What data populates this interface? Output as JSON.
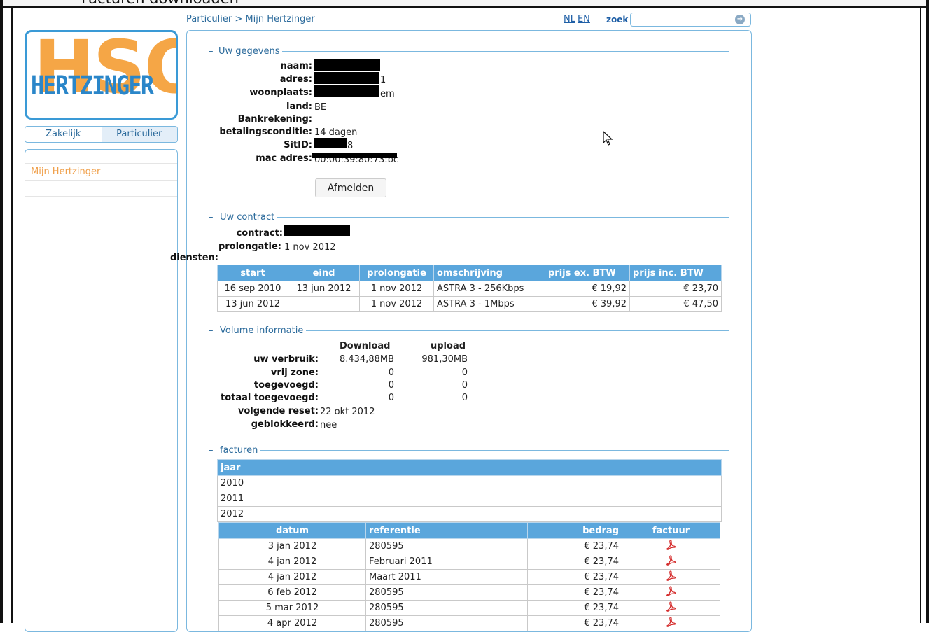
{
  "window": {
    "title": "Facturen downloaden"
  },
  "header": {
    "breadcrumb": "Particulier > Mijn Hertzinger",
    "lang_nl": "NL",
    "lang_en": "EN",
    "search_label": "zoek",
    "search_value": ""
  },
  "sidebar": {
    "logo_letters": "HSO",
    "logo_name": "HERTZINGER",
    "tab_zakelijk": "Zakelijk",
    "tab_particulier": "Particulier",
    "menu_item": "Mijn Hertzinger"
  },
  "gegevens": {
    "legend": "Uw gegevens",
    "naam_label": "naam:",
    "adres_label": "adres:",
    "adres_tail": "1",
    "woonplaats_label": "woonplaats:",
    "woonplaats_tail": "em",
    "land_label": "land:",
    "land_value": "BE",
    "bank_label": "Bankrekening:",
    "betaling_label": "betalingsconditie:",
    "betaling_value": "14 dagen",
    "sitid_label": "SitID:",
    "sitid_tail": "8",
    "mac_label": "mac adres:",
    "mac_value": "00:00:39:80:73:bc",
    "logout": "Afmelden"
  },
  "contract": {
    "legend": "Uw contract",
    "contract_label": "contract:",
    "prolongatie_label": "prolongatie:",
    "prolongatie_value": "1 nov 2012",
    "diensten_label": "diensten:",
    "headers": [
      "start",
      "eind",
      "prolongatie",
      "omschrijving",
      "prijs ex. BTW",
      "prijs inc. BTW"
    ],
    "rows": [
      [
        "16 sep 2010",
        "13 jun 2012",
        "1 nov 2012",
        "ASTRA 3 - 256Kbps",
        "€ 19,92",
        "€ 23,70"
      ],
      [
        "13 jun 2012",
        "",
        "1 nov 2012",
        "ASTRA 3 - 1Mbps",
        "€ 39,92",
        "€ 47,50"
      ]
    ]
  },
  "volume": {
    "legend": "Volume informatie",
    "col_download": "Download",
    "col_upload": "upload",
    "verbruik_label": "uw verbruik:",
    "verbruik_down": "8.434,88MB",
    "verbruik_up": "981,30MB",
    "vrij_label": "vrij zone:",
    "vrij_down": "0",
    "vrij_up": "0",
    "toeg_label": "toegevoegd:",
    "toeg_down": "0",
    "toeg_up": "0",
    "totaal_label": "totaal toegevoegd:",
    "totaal_down": "0",
    "totaal_up": "0",
    "reset_label": "volgende reset:",
    "reset_value": "22 okt 2012",
    "blok_label": "geblokkeerd:",
    "blok_value": "nee"
  },
  "facturen": {
    "legend": "facturen",
    "year_header": "jaar",
    "years": [
      "2010",
      "2011",
      "2012"
    ],
    "headers": [
      "datum",
      "referentie",
      "bedrag",
      "factuur"
    ],
    "rows": [
      [
        "3 jan 2012",
        "280595",
        "€ 23,74"
      ],
      [
        "4 jan 2012",
        "Februari 2011",
        "€ 23,74"
      ],
      [
        "4 jan 2012",
        "Maart 2011",
        "€ 23,74"
      ],
      [
        "6 feb 2012",
        "280595",
        "€ 23,74"
      ],
      [
        "5 mar 2012",
        "280595",
        "€ 23,74"
      ],
      [
        "4 apr 2012",
        "280595",
        "€ 23,74"
      ]
    ],
    "pdf_icon": "pdf-icon"
  }
}
